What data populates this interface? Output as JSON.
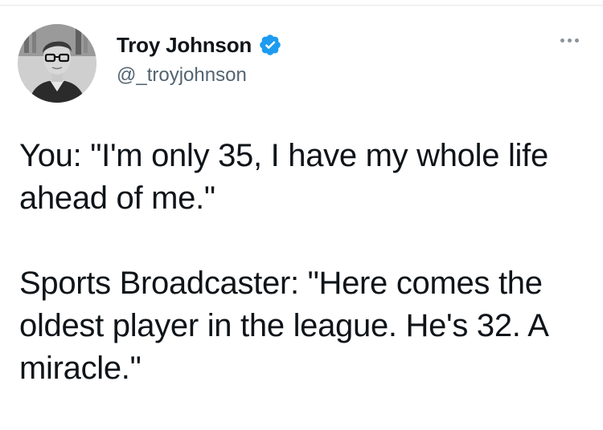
{
  "tweet": {
    "author": {
      "display_name": "Troy Johnson",
      "handle": "@_troyjohnson",
      "verified": true,
      "avatar_icon": "profile-photo",
      "verified_icon": "verified-badge-icon",
      "verified_color": "#1d9bf0"
    },
    "more_icon": "more-options-icon",
    "paragraphs": [
      "You: \"I'm only 35, I have my whole life ahead of me.\"",
      "Sports Broadcaster: \"Here comes the oldest player in the league. He's 32. A miracle.\""
    ]
  },
  "colors": {
    "text": "#0f1419",
    "secondary_text": "#536471",
    "background": "#ffffff"
  }
}
